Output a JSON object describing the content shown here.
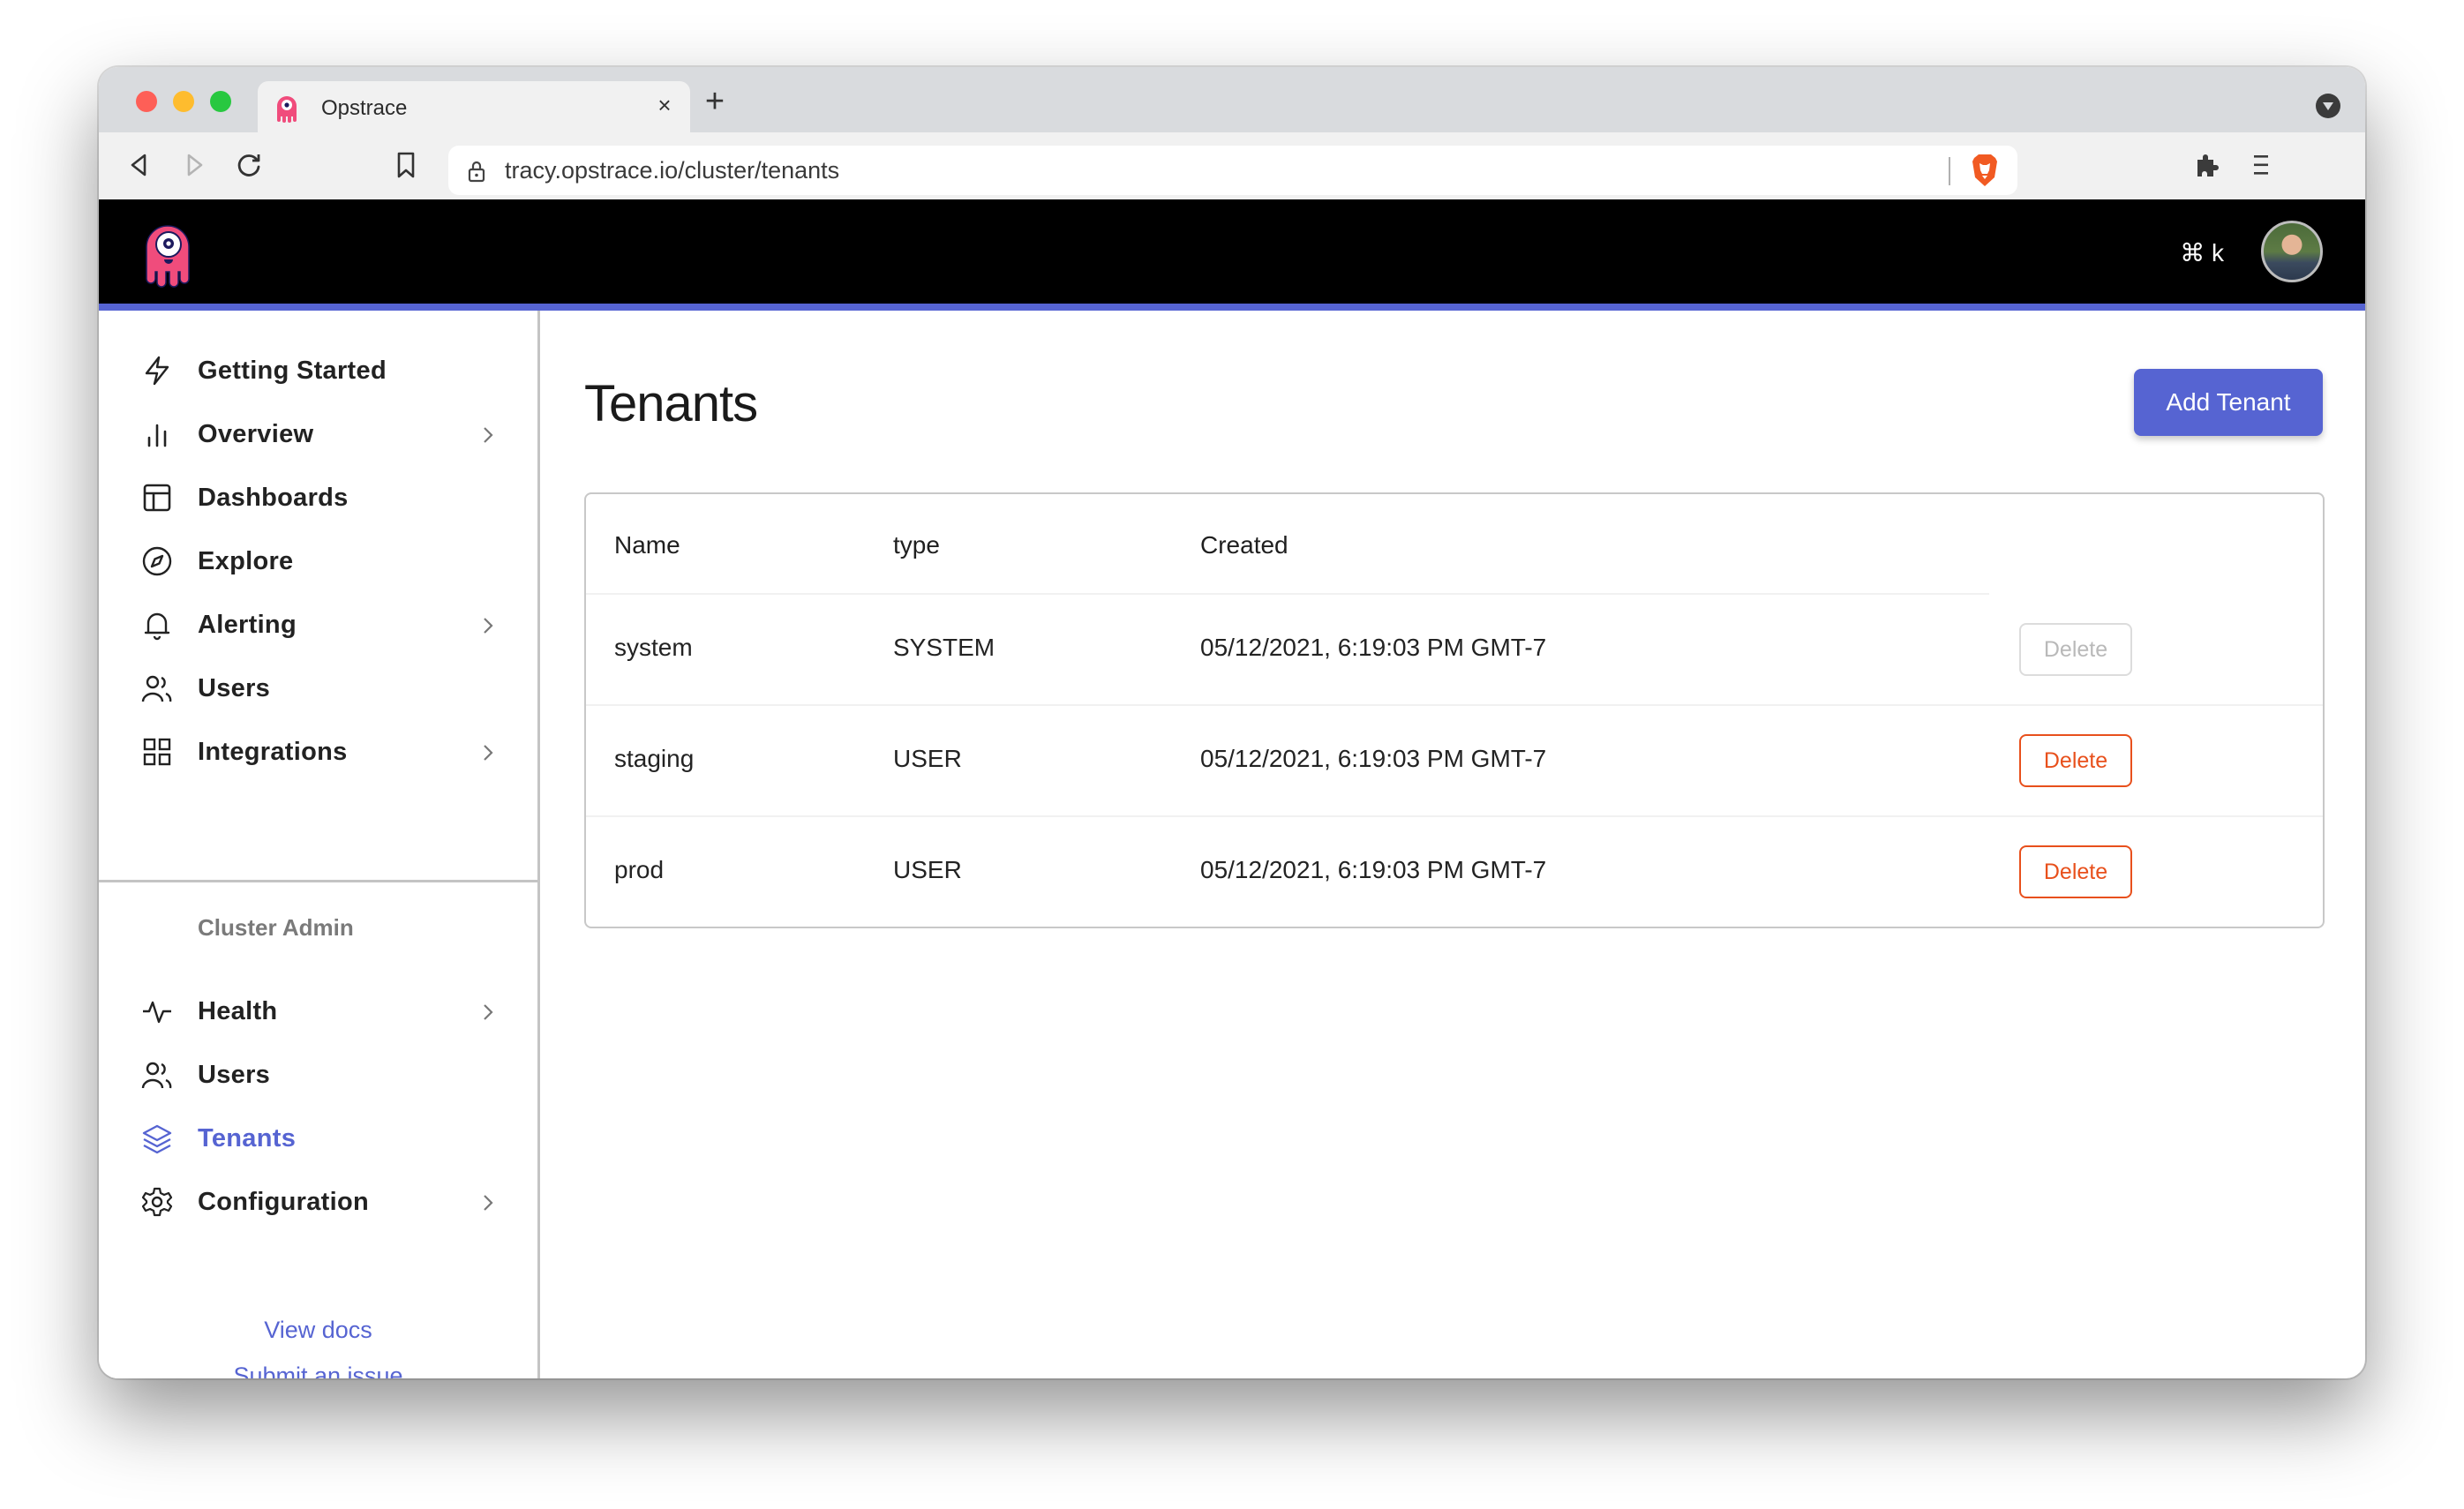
{
  "browser": {
    "tab_title": "Opstrace",
    "tab_close": "×",
    "new_tab": "+",
    "url": "tracy.opstrace.io/cluster/tenants",
    "icons": [
      "back-icon",
      "forward-icon",
      "reload-icon",
      "bookmark-icon",
      "lock-icon",
      "brave-shield-icon",
      "extensions-icon",
      "menu-icon",
      "tab-search-icon"
    ]
  },
  "header": {
    "shortcut": "⌘ k",
    "logo": "opstrace-logo",
    "avatar": "user-avatar"
  },
  "colors": {
    "accent": "#5664d2",
    "danger": "#e8501c",
    "logo_pink": "#f04c7c"
  },
  "sidebar": {
    "items": [
      {
        "label": "Getting Started",
        "icon": "lightning-icon",
        "chevron": false
      },
      {
        "label": "Overview",
        "icon": "bar-chart-icon",
        "chevron": true
      },
      {
        "label": "Dashboards",
        "icon": "layout-icon",
        "chevron": false
      },
      {
        "label": "Explore",
        "icon": "compass-icon",
        "chevron": false
      },
      {
        "label": "Alerting",
        "icon": "bell-icon",
        "chevron": true
      },
      {
        "label": "Users",
        "icon": "users-icon",
        "chevron": false
      },
      {
        "label": "Integrations",
        "icon": "grid-icon",
        "chevron": true
      }
    ],
    "section_label": "Cluster Admin",
    "admin_items": [
      {
        "label": "Health",
        "icon": "activity-icon",
        "chevron": true
      },
      {
        "label": "Users",
        "icon": "users-icon",
        "chevron": false
      },
      {
        "label": "Tenants",
        "icon": "layers-icon",
        "chevron": false,
        "active": true
      },
      {
        "label": "Configuration",
        "icon": "gear-icon",
        "chevron": true
      }
    ],
    "footer_links": [
      "View docs",
      "Submit an issue"
    ]
  },
  "main": {
    "title": "Tenants",
    "add_button": "Add Tenant",
    "table": {
      "columns": [
        "Name",
        "type",
        "Created"
      ],
      "rows": [
        {
          "name": "system",
          "type": "SYSTEM",
          "created": "05/12/2021, 6:19:03 PM GMT-7",
          "action": "Delete",
          "action_disabled": true
        },
        {
          "name": "staging",
          "type": "USER",
          "created": "05/12/2021, 6:19:03 PM GMT-7",
          "action": "Delete",
          "action_disabled": false
        },
        {
          "name": "prod",
          "type": "USER",
          "created": "05/12/2021, 6:19:03 PM GMT-7",
          "action": "Delete",
          "action_disabled": false
        }
      ]
    }
  }
}
